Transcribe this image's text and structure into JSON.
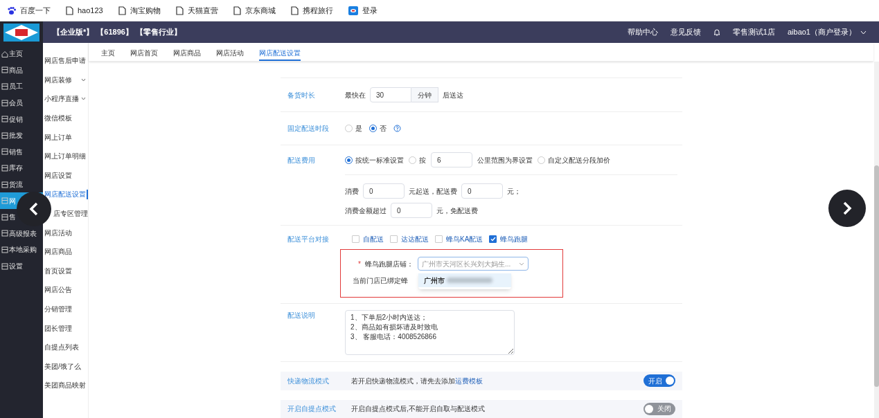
{
  "bookmarks": [
    {
      "kind": "paw",
      "label": "百度一下"
    },
    {
      "kind": "page",
      "label": "hao123"
    },
    {
      "kind": "page",
      "label": "淘宝购物"
    },
    {
      "kind": "page",
      "label": "天猫直营"
    },
    {
      "kind": "page",
      "label": "京东商城"
    },
    {
      "kind": "page",
      "label": "携程旅行"
    },
    {
      "kind": "app",
      "label": "登录"
    }
  ],
  "header": {
    "tags": [
      "【企业版*】",
      "【61896】",
      "【零售行业】"
    ],
    "links": [
      "帮助中心",
      "意见反馈"
    ],
    "store": "零售测试1店",
    "user": "aibao1（商户登录）"
  },
  "nav": [
    {
      "label": "主页",
      "selected": false
    },
    {
      "label": "商品",
      "selected": false
    },
    {
      "label": "员工",
      "selected": false
    },
    {
      "label": "会员",
      "selected": false
    },
    {
      "label": "促销",
      "selected": false
    },
    {
      "label": "批发",
      "selected": false
    },
    {
      "label": "销售",
      "selected": false
    },
    {
      "label": "库存",
      "selected": false
    },
    {
      "label": "货流",
      "selected": false
    },
    {
      "label": "网",
      "selected": true
    },
    {
      "label": "售",
      "selected": false
    },
    {
      "label": "高级报表",
      "selected": false
    },
    {
      "label": "本地采购",
      "selected": false
    },
    {
      "label": "设置",
      "selected": false
    }
  ],
  "subnav": [
    {
      "label": "网店售后申请",
      "selected": false,
      "expandable": false
    },
    {
      "label": "网店装修",
      "selected": false,
      "expandable": true
    },
    {
      "label": "小程序直播",
      "selected": false,
      "expandable": true
    },
    {
      "label": "微信模板",
      "selected": false,
      "expandable": false
    },
    {
      "label": "网上订单",
      "selected": false,
      "expandable": false
    },
    {
      "label": "网上订单明细",
      "selected": false,
      "expandable": false
    },
    {
      "label": "网店设置",
      "selected": false,
      "expandable": false
    },
    {
      "label": "网店配送设置",
      "selected": true,
      "expandable": false
    },
    {
      "label": "店专区管理",
      "selected": false,
      "expandable": false
    },
    {
      "label": "网店活动",
      "selected": false,
      "expandable": false
    },
    {
      "label": "网店商品",
      "selected": false,
      "expandable": false
    },
    {
      "label": "首页设置",
      "selected": false,
      "expandable": false
    },
    {
      "label": "网店公告",
      "selected": false,
      "expandable": false
    },
    {
      "label": "分销管理",
      "selected": false,
      "expandable": false
    },
    {
      "label": "团长管理",
      "selected": false,
      "expandable": false
    },
    {
      "label": "自提点列表",
      "selected": false,
      "expandable": false
    },
    {
      "label": "美团/饿了么",
      "selected": false,
      "expandable": false
    },
    {
      "label": "美团商品映射",
      "selected": false,
      "expandable": false
    }
  ],
  "tabs": [
    {
      "label": "主页",
      "selected": false
    },
    {
      "label": "网店首页",
      "selected": false
    },
    {
      "label": "网店商品",
      "selected": false
    },
    {
      "label": "网店活动",
      "selected": false
    },
    {
      "label": "网店配送设置",
      "selected": true
    }
  ],
  "form": {
    "prep": {
      "label": "备货时长",
      "prefix": "最快在",
      "value": "30",
      "unit": "分钟",
      "suffix": "后送达"
    },
    "fixed": {
      "label": "固定配送时段",
      "options": [
        {
          "label": "是",
          "selected": false
        },
        {
          "label": "否",
          "selected": true
        }
      ]
    },
    "fee": {
      "label": "配送费用",
      "options": [
        {
          "label": "按统一标准设置",
          "selected": true
        },
        {
          "label": "按",
          "selected": false
        },
        {
          "label": "自定义配送分段加价",
          "selected": false
        }
      ],
      "km_value": "6",
      "km_suffix": "公里范围为界设置",
      "line1": {
        "t1": "消费",
        "v1": "0",
        "t2": "元起送，配送费",
        "v2": "0",
        "t3": "元；"
      },
      "line2": {
        "t1": "消费金额超过",
        "v1": "0",
        "t2": "元，免配送费"
      }
    },
    "platform": {
      "label": "配送平台对接",
      "options": [
        {
          "label": "自配送",
          "checked": false
        },
        {
          "label": "达达配送",
          "checked": false
        },
        {
          "label": "蜂鸟KA配送",
          "checked": false
        },
        {
          "label": "蜂鸟跑腿",
          "checked": true
        }
      ],
      "required_mark": "*",
      "store_label": "蜂鸟跑腿店铺：",
      "store_placeholder": "广州市天河区长兴刘大妈生...",
      "hint": "当前门店已绑定蜂",
      "dropdown": [
        {
          "label": "广州市",
          "selected": true
        }
      ]
    },
    "note": {
      "label": "配送说明",
      "lines": [
        "1、下单后2小时内送达；",
        "2、商品如有损坏请及时致电",
        "3、 客服电话：4008526866"
      ]
    }
  },
  "modes": [
    {
      "label": "快递物流模式",
      "desc": "若开启快递物流模式，请先去添加",
      "link": "运费模板",
      "on": true,
      "toggle_text": "开启"
    },
    {
      "label": "开启自提点模式",
      "desc": "开启自提点模式后,不能开启自取与配送模式",
      "on": false,
      "toggle_text": "关闭"
    }
  ]
}
